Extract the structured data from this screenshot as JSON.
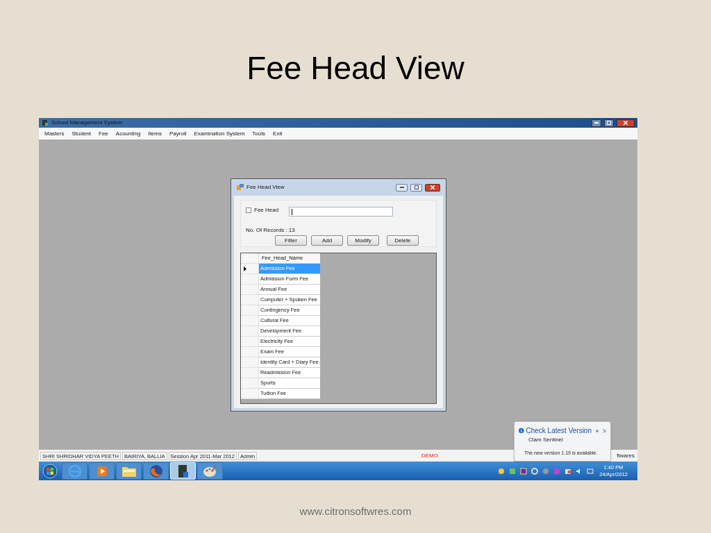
{
  "slide": {
    "title": "Fee Head View",
    "footer": "www.citronsoftwres.com"
  },
  "window": {
    "title": "School Management System",
    "menu": [
      "Masters",
      "Student",
      "Fee",
      "Acounting",
      "Items",
      "Payroll",
      "Examination System",
      "Tools",
      "Exit"
    ]
  },
  "child_window": {
    "title": "Fee Head View",
    "filter_checkbox": {
      "label": "Fee Head",
      "checked": false
    },
    "records": "No. Of Records : 13",
    "buttons": [
      "Filter",
      "Add",
      "Modify",
      "Delete"
    ],
    "grid": {
      "columns": [
        "Fee_Head_Name"
      ],
      "rows": [
        {
          "name": "Admission Fee",
          "selected": true
        },
        {
          "name": "Admission Form Fee",
          "selected": false
        },
        {
          "name": "Annual Fee",
          "selected": false
        },
        {
          "name": "Computer + Spoken Fee",
          "selected": false
        },
        {
          "name": "Contingency Fee",
          "selected": false
        },
        {
          "name": "Cultural Fee",
          "selected": false
        },
        {
          "name": "Development Fee",
          "selected": false
        },
        {
          "name": "Electricity Fee",
          "selected": false
        },
        {
          "name": "Exam Fee",
          "selected": false
        },
        {
          "name": "Identity Card + Diary Fee",
          "selected": false
        },
        {
          "name": "Readmission Fee",
          "selected": false
        },
        {
          "name": "Sports",
          "selected": false
        },
        {
          "name": "Tuition Fee",
          "selected": false
        }
      ]
    }
  },
  "status_bar": {
    "panels": [
      "SHRI SHRIDHAR VIDYA PEETH",
      "BAIRIYA, BALLIA",
      "Session Apr 2011-Mar 2012",
      "Admin"
    ],
    "demo": "DEMO",
    "credit": "ftwares"
  },
  "notification": {
    "title": "Check Latest Version",
    "source": "Clam Sentinel",
    "message": "The new version 1.19 is available."
  },
  "taskbar": {
    "apps": [
      {
        "kind": "browser",
        "selected": false
      },
      {
        "kind": "media",
        "selected": false
      },
      {
        "kind": "folder",
        "selected": false
      },
      {
        "kind": "fox",
        "selected": false
      },
      {
        "kind": "app",
        "selected": true
      },
      {
        "kind": "paint",
        "selected": false
      }
    ],
    "clock": {
      "time": "1:40 PM",
      "date": "24/Apr/2012"
    }
  }
}
